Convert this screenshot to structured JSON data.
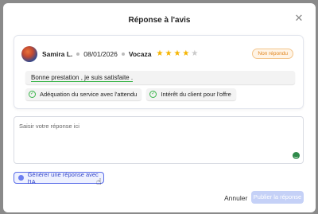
{
  "modal": {
    "title": "Réponse à l'avis",
    "close_icon": "close-icon"
  },
  "review": {
    "author": "Samira L.",
    "date": "08/01/2026",
    "source": "Vocaza",
    "rating": 4,
    "rating_max": 5,
    "status_badge": "Non répondu",
    "text": "Bonne prestation , je suis satisfaite .",
    "tags": [
      {
        "label": "Adéquation du service avec l'attendu",
        "icon": "check-circle-icon"
      },
      {
        "label": "Intérêt du client pour l'offre",
        "icon": "check-circle-icon"
      }
    ]
  },
  "reply": {
    "value": "",
    "placeholder": "Saisir votre réponse ici"
  },
  "ai_button": {
    "label": "Générer une réponse avec l'IA"
  },
  "footer": {
    "cancel_label": "Annuler",
    "publish_label": "Publier la réponse"
  },
  "colors": {
    "accent": "#5b6ee8",
    "star": "#f5b400",
    "badge_text": "#e0831a",
    "tag_check": "#3ab54a"
  }
}
